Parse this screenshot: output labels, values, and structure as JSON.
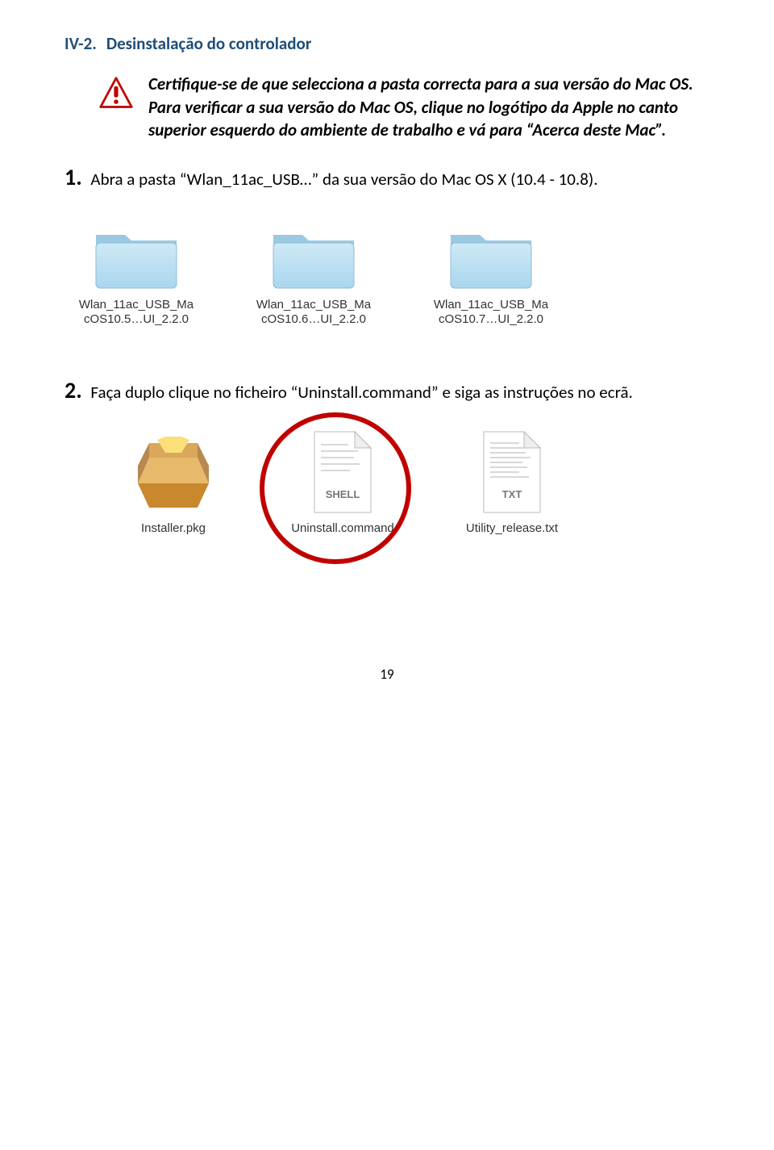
{
  "heading": {
    "number": "IV-2.",
    "title": "Desinstalação do controlador"
  },
  "warning": "Certifique-se de que selecciona a pasta correcta para a sua versão do Mac OS. Para verificar a sua versão do Mac OS, clique no logótipo da Apple no canto superior esquerdo do ambiente de trabalho e vá para “Acerca deste Mac”.",
  "steps": [
    {
      "num": "1.",
      "text": " Abra a pasta “Wlan_11ac_USB…” da sua versão do Mac OS X (10.4 - 10.8)."
    },
    {
      "num": "2.",
      "text": " Faça duplo clique no ficheiro “Uninstall.command” e siga as instruções no ecrã."
    }
  ],
  "folders": [
    {
      "line1": "Wlan_11ac_USB_Ma",
      "line2": "cOS10.5…UI_2.2.0"
    },
    {
      "line1": "Wlan_11ac_USB_Ma",
      "line2": "cOS10.6…UI_2.2.0"
    },
    {
      "line1": "Wlan_11ac_USB_Ma",
      "line2": "cOS10.7…UI_2.2.0"
    }
  ],
  "files": [
    {
      "name": "Installer.pkg",
      "type": "pkg"
    },
    {
      "name": "Uninstall.command",
      "type": "shell",
      "badge": "SHELL",
      "highlight": true
    },
    {
      "name": "Utility_release.txt",
      "type": "txt",
      "badge": "TXT"
    }
  ],
  "page_number": "19"
}
